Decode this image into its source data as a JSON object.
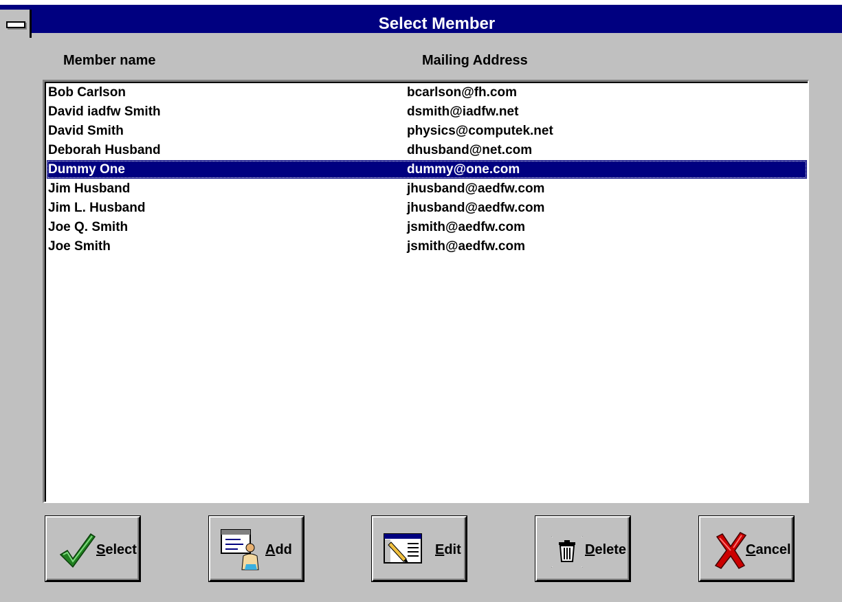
{
  "window": {
    "title": "Select Member"
  },
  "columns": {
    "name": "Member name",
    "address": "Mailing Address"
  },
  "members": [
    {
      "name": "Bob Carlson",
      "address": "bcarlson@fh.com"
    },
    {
      "name": "David iadfw Smith",
      "address": "dsmith@iadfw.net"
    },
    {
      "name": "David Smith",
      "address": "physics@computek.net"
    },
    {
      "name": "Deborah Husband",
      "address": "dhusband@net.com"
    },
    {
      "name": "Dummy One",
      "address": "dummy@one.com"
    },
    {
      "name": "Jim Husband",
      "address": "jhusband@aedfw.com"
    },
    {
      "name": "Jim L. Husband",
      "address": "jhusband@aedfw.com"
    },
    {
      "name": "Joe Q. Smith",
      "address": "jsmith@aedfw.com"
    },
    {
      "name": "Joe Smith",
      "address": "jsmith@aedfw.com"
    }
  ],
  "selected_member": "Dummy One",
  "buttons": {
    "select": {
      "underlined": "S",
      "rest": "elect",
      "icon": "checkmark-icon"
    },
    "add": {
      "underlined": "A",
      "rest": "dd",
      "icon": "add-person-icon"
    },
    "edit": {
      "underlined": "E",
      "rest": "dit",
      "icon": "edit-document-icon"
    },
    "delete": {
      "underlined": "D",
      "rest": "elete",
      "icon": "trash-icon"
    },
    "cancel": {
      "underlined": "C",
      "rest": "ancel",
      "icon": "red-x-icon"
    }
  },
  "colors": {
    "titlebar": "#000080",
    "selection": "#000080",
    "face": "#c0c0c0"
  }
}
